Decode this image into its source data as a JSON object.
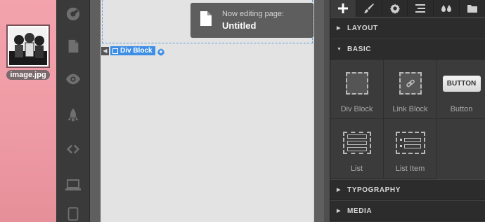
{
  "desktop": {
    "file_name": "image.jpg"
  },
  "left_toolbar": {
    "items": [
      "settings-icon",
      "page-icon",
      "eye-icon",
      "rocket-icon",
      "code-icon",
      "laptop-icon",
      "tablet-icon"
    ]
  },
  "canvas": {
    "selected_element": "Div Block"
  },
  "toast": {
    "line1": "Now editing page:",
    "line2": "Untitled"
  },
  "panel": {
    "tabs": [
      "add-icon",
      "brush-icon",
      "gear-icon",
      "navigator-icon",
      "drops-icon",
      "folder-icon"
    ],
    "sections": {
      "layout": "LAYOUT",
      "basic": "BASIC",
      "typography": "TYPOGRAPHY",
      "media": "MEDIA"
    },
    "elements": {
      "div_block": "Div Block",
      "link_block": "Link Block",
      "button": "Button",
      "button_chip": "BUTTON",
      "list": "List",
      "list_item": "List Item"
    }
  }
}
